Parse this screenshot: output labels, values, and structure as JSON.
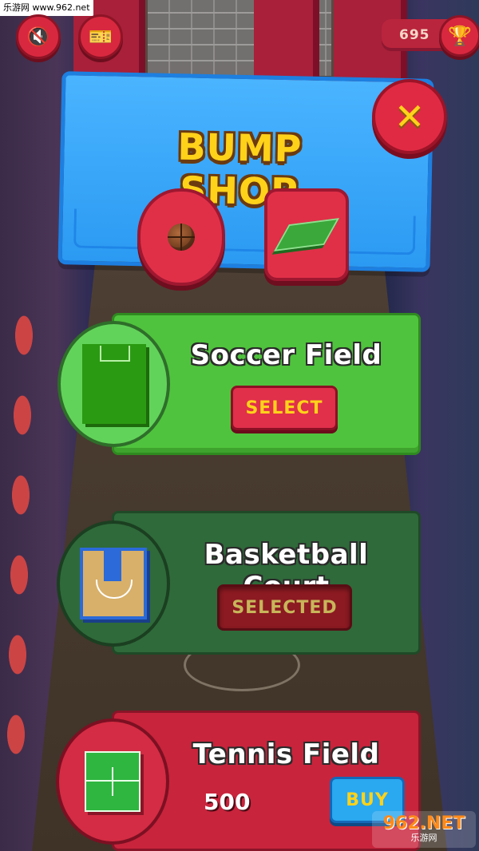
{
  "watermark": {
    "top_text": "乐游网 www.962.net",
    "logo_text": "962.NET",
    "logo_sub": "乐游网"
  },
  "hud": {
    "sound_icon": "speaker-muted-icon",
    "ticket_icon": "ticket-icon",
    "score": "695",
    "trophy_icon": "trophy-icon"
  },
  "shop": {
    "title": "BUMP SHOP",
    "close_label": "✕",
    "categories": [
      {
        "name": "ball",
        "icon": "basketball-icon"
      },
      {
        "name": "field",
        "icon": "field-icon"
      }
    ]
  },
  "items": [
    {
      "name": "Soccer Field",
      "action": "SELECT",
      "state": "available",
      "color": "#4fc33d"
    },
    {
      "name": "Basketball Court",
      "action": "SELECTED",
      "state": "selected",
      "color": "#2f6a3a"
    },
    {
      "name": "Tennis Field",
      "price": "500",
      "action": "BUY",
      "state": "locked",
      "color": "#c8243c"
    }
  ],
  "colors": {
    "accent_red": "#e0304a",
    "title_yellow": "#ffd21a",
    "panel_blue": "#2b9af2"
  }
}
